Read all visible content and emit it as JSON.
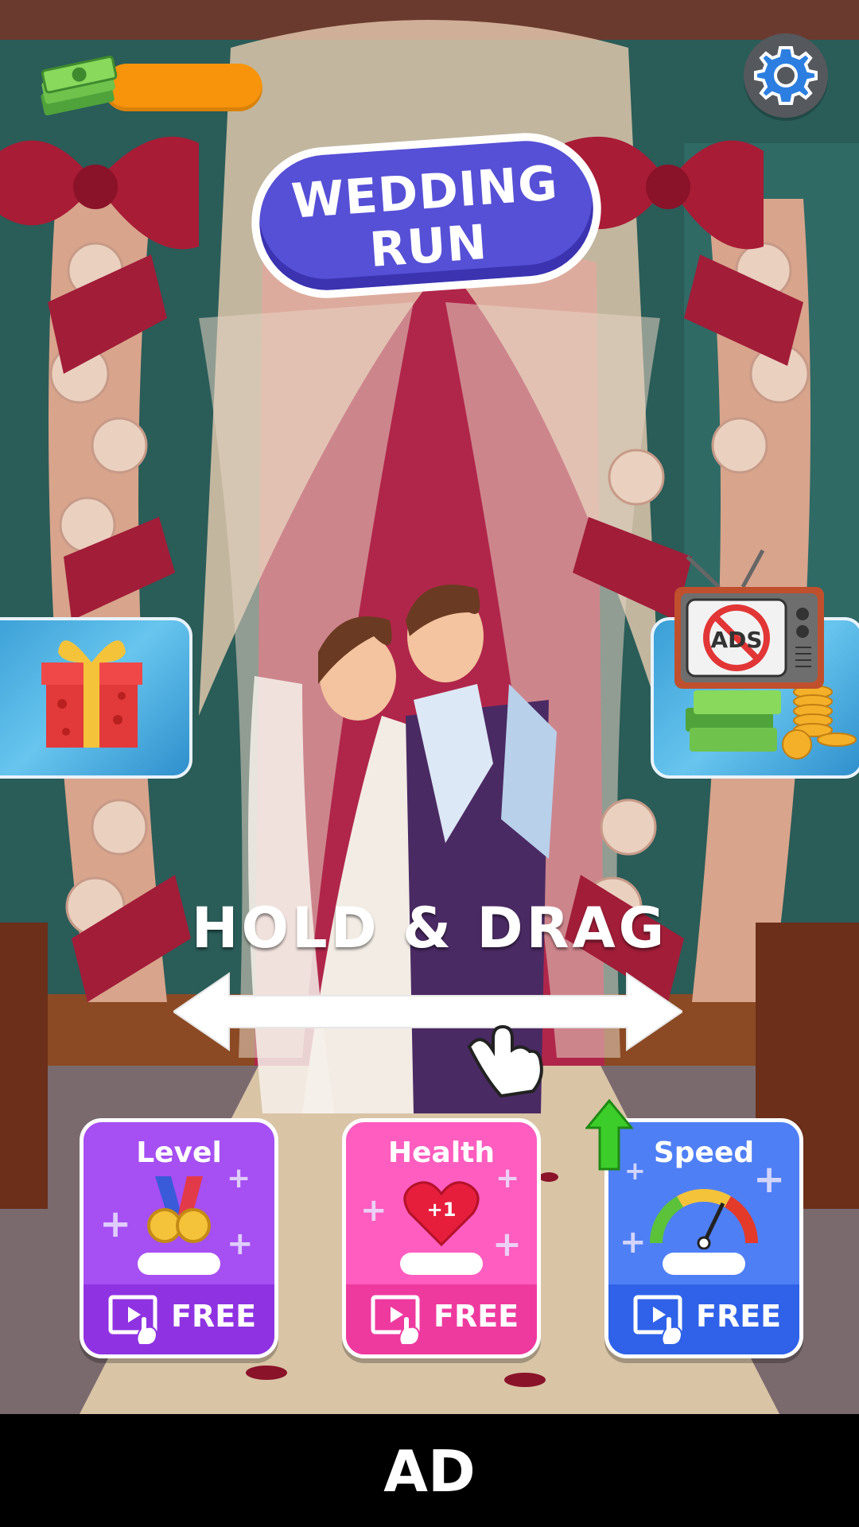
{
  "game": {
    "title_line1": "WEDDING",
    "title_line2": "RUN"
  },
  "hud": {
    "money_icon": "cash-stack-icon",
    "money_bar_color": "#f7940c",
    "settings_icon": "gear-icon"
  },
  "side_panels": {
    "left": {
      "icon": "gift-box-icon"
    },
    "right": {
      "icon": "no-ads-tv-icon",
      "tv_text": "ADS"
    }
  },
  "tutorial": {
    "instruction": "HOLD & DRAG",
    "arrow_icon": "double-arrow-icon",
    "hand_icon": "pointer-hand-icon"
  },
  "upgrades": [
    {
      "title": "Level",
      "icon": "medals-icon",
      "action": "FREE",
      "color": "#a64ff2"
    },
    {
      "title": "Health",
      "icon": "heart-plus-one-icon",
      "heart_text": "+1",
      "action": "FREE",
      "color": "#ff5dbf"
    },
    {
      "title": "Speed",
      "icon": "speedometer-icon",
      "action": "FREE",
      "color": "#4f7ff5",
      "upgrade_icon": "green-up-arrow-icon"
    }
  ],
  "ad_bar": {
    "label": "AD"
  }
}
